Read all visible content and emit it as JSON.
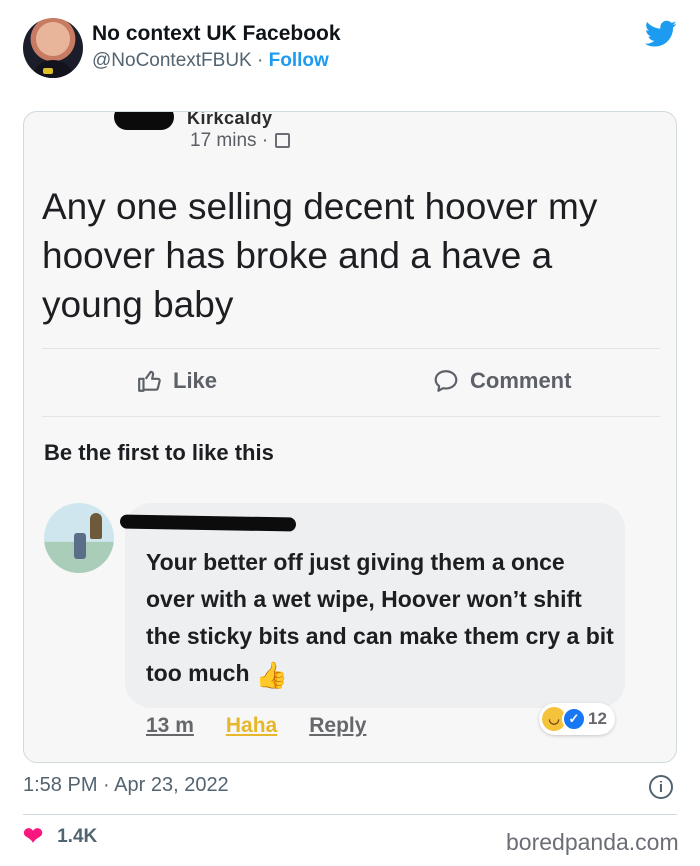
{
  "account": {
    "name": "No context UK Facebook",
    "handle": "@NoContextFBUK",
    "separator": "·",
    "follow_label": "Follow"
  },
  "post": {
    "poster_name_partial": "Kirkcaldy",
    "time": "17 mins",
    "separator": "·",
    "text": "Any one selling decent hoover my hoover has broke and a have a young baby",
    "like_label": "Like",
    "comment_label": "Comment",
    "likes_summary": "Be the first to like this"
  },
  "comment": {
    "text": "Your better off just giving them a once over with a wet wipe, Hoover won’t shift the sticky bits and can make them cry a bit too much",
    "emoji": "👍",
    "time": "13 m",
    "reaction_label": "Haha",
    "reply_label": "Reply",
    "reaction_count": "12"
  },
  "tweet_meta": {
    "datetime": "1:58 PM · Apr 23, 2022",
    "like_count": "1.4K",
    "info_icon": "i"
  },
  "watermark": "boredpanda.com",
  "colors": {
    "twitter_blue": "#1d9bf0",
    "heart_pink": "#f91880",
    "haha_yellow": "#e6b72b",
    "facebook_blue": "#1877f2"
  }
}
